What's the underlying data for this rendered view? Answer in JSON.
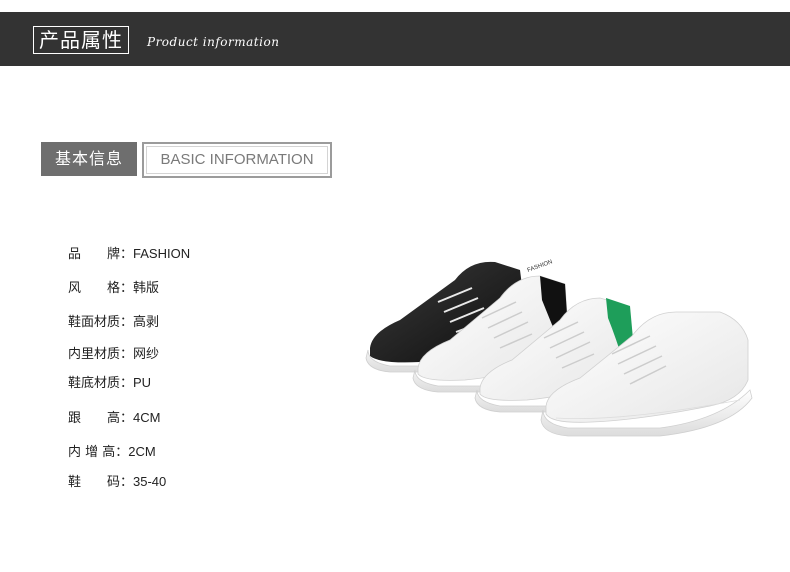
{
  "header": {
    "title": "产品属性",
    "subtitle": "Product information"
  },
  "section": {
    "title_cn": "基本信息",
    "title_en": "BASIC INFORMATION"
  },
  "specs": [
    {
      "label": "品　　牌：",
      "value": "FASHION"
    },
    {
      "label": "风　　格：",
      "value": "韩版"
    },
    {
      "label": "鞋面材质：",
      "value": "高剥"
    },
    {
      "label": "内里材质：",
      "value": "网纱"
    },
    {
      "label": "鞋底材质：",
      "value": "PU"
    },
    {
      "label": "跟　　高：",
      "value": "4CM"
    },
    {
      "label": "内 增 高：",
      "value": "2CM"
    },
    {
      "label": "鞋　　码：",
      "value": "35-40"
    }
  ],
  "product": {
    "tongue_label": "FASHION",
    "colors": {
      "black": "#1a1a1a",
      "white": "#f7f7f7",
      "green": "#1e9e5a",
      "header_bg": "#333333",
      "section_bg": "#6e6e6e"
    }
  }
}
